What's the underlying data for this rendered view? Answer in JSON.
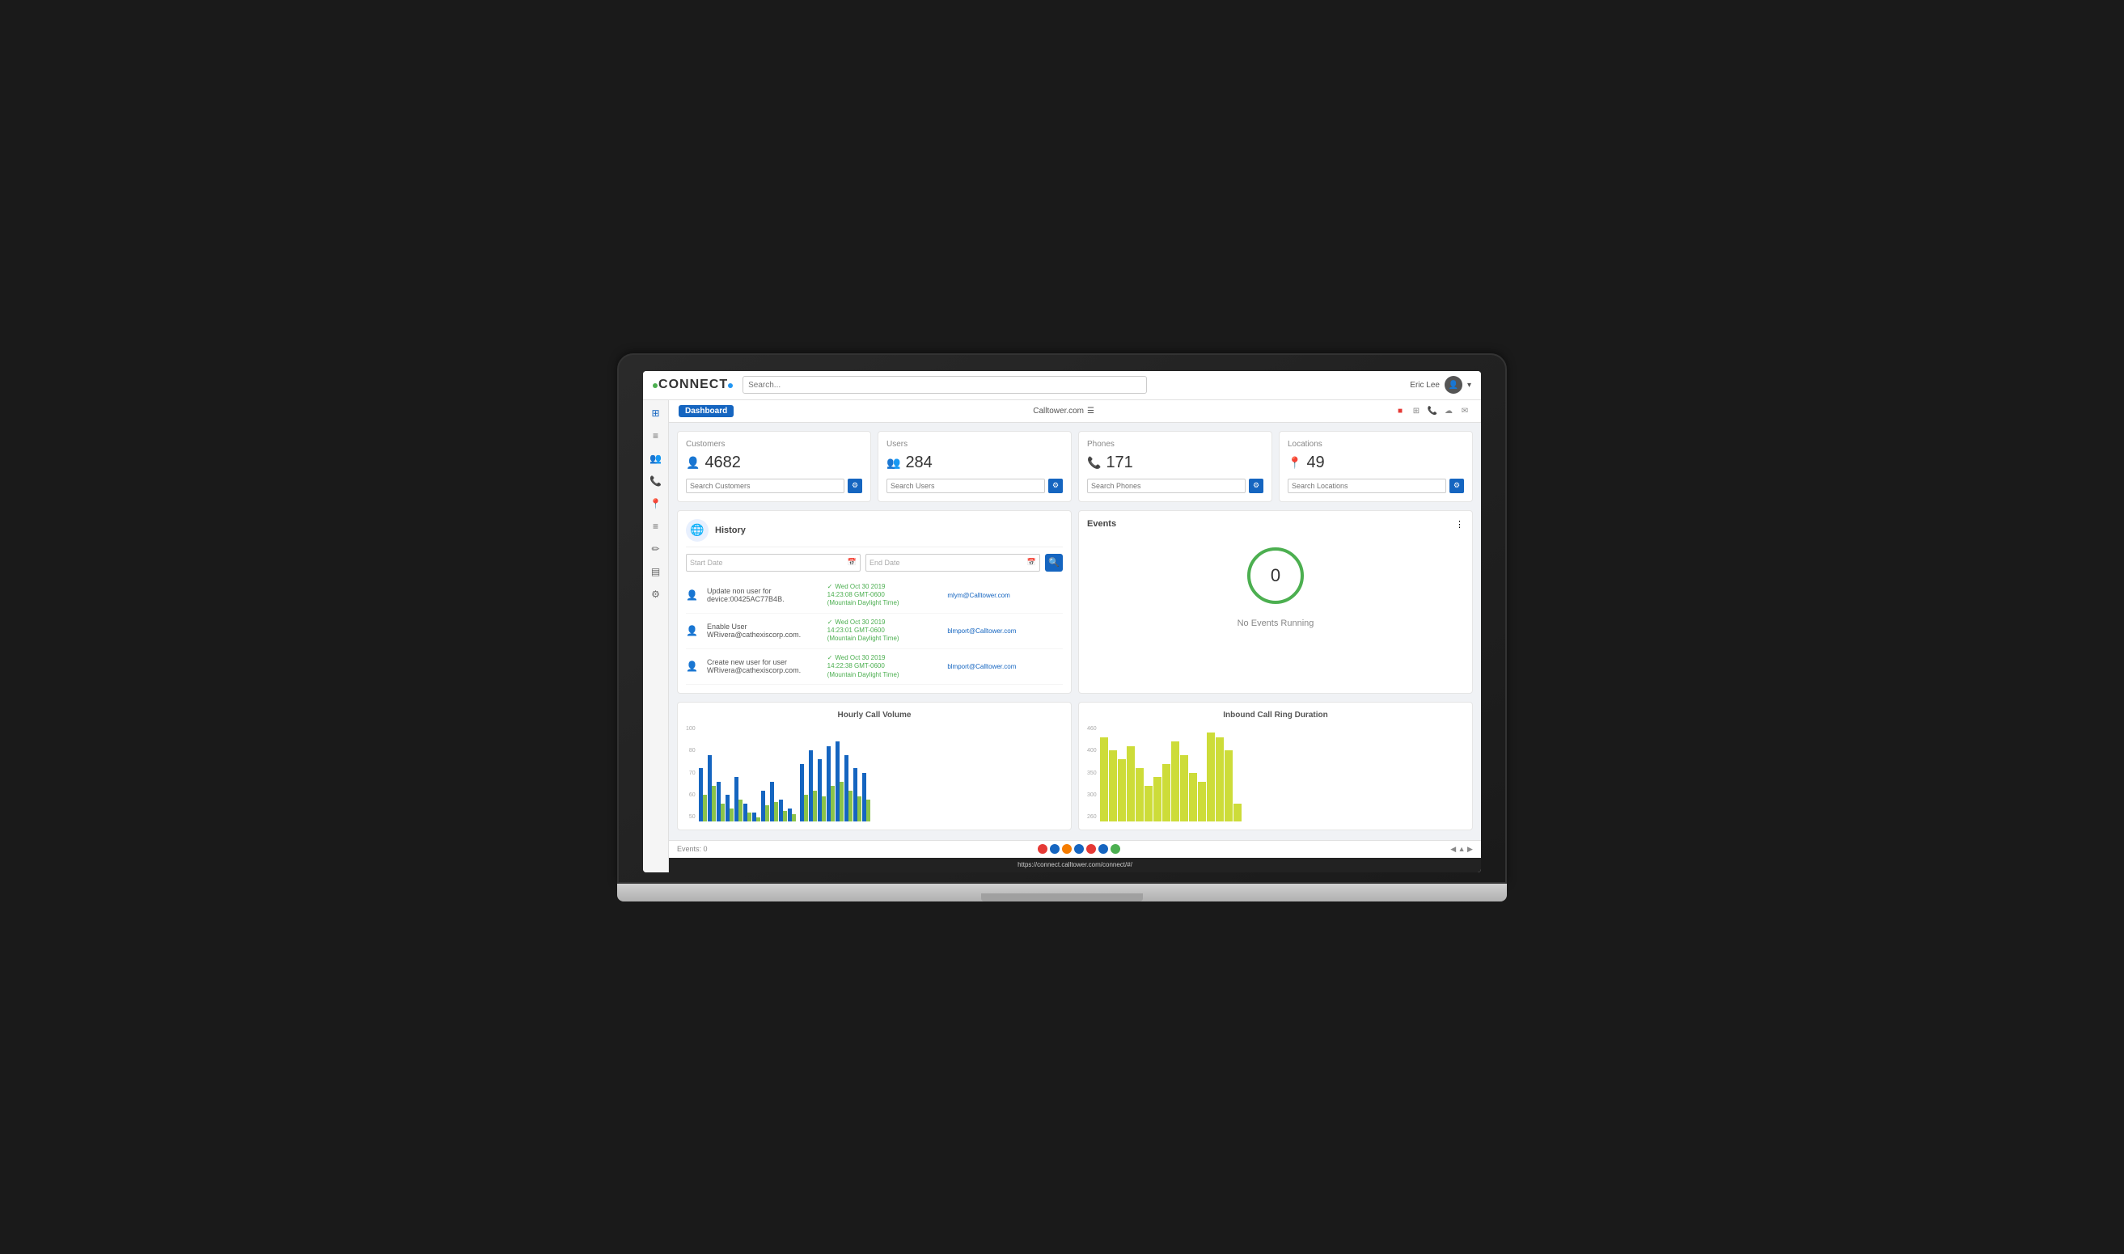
{
  "app": {
    "title": "CONNECT",
    "logo_c": "C",
    "logo_rest": "ONNECT"
  },
  "navbar": {
    "search_placeholder": "Search...",
    "user_name": "Eric Lee"
  },
  "topbar": {
    "dashboard_tab": "Dashboard",
    "calltower_label": "Calltower.com"
  },
  "stats": [
    {
      "label": "Customers",
      "value": "4682",
      "icon": "👤",
      "icon_class": "customers",
      "search_placeholder": "Search Customers"
    },
    {
      "label": "Users",
      "value": "284",
      "icon": "👥",
      "icon_class": "users",
      "search_placeholder": "Search Users"
    },
    {
      "label": "Phones",
      "value": "171",
      "icon": "📞",
      "icon_class": "phones",
      "search_placeholder": "Search Phones"
    },
    {
      "label": "Locations",
      "value": "49",
      "icon": "📍",
      "icon_class": "locations",
      "search_placeholder": "Search Locations"
    }
  ],
  "history": {
    "title": "History",
    "start_date_placeholder": "Start Date",
    "end_date_placeholder": "End Date",
    "items": [
      {
        "description": "Update non user for device:00425AC77B4B.",
        "time": "✓ Wed Oct 30 2019\n14:23:08 GMT-0600\n(Mountain Daylight Time)",
        "user": "mlym@Calltower.com",
        "icon": "person"
      },
      {
        "description": "Enable User WRivera@cathexiscorp.com.",
        "time": "✓ Wed Oct 30 2019\n14:23:01 GMT-0600\n(Mountain Daylight Time)",
        "user": "blmport@Calltower.com",
        "icon": "person"
      },
      {
        "description": "Create new user for user WRivera@cathexiscorp.com.",
        "time": "✓ Wed Oct 30 2019\n14:22:38 GMT-0600\n(Mountain Daylight Time)",
        "user": "blmport@Calltower.com",
        "icon": "person"
      }
    ]
  },
  "events": {
    "title": "Events",
    "count": "0",
    "no_events_text": "No Events Running"
  },
  "hourly_chart": {
    "title": "Hourly Call Volume",
    "y_labels": [
      "100",
      "80",
      "60",
      "50"
    ],
    "bars": [
      {
        "blue": 60,
        "green": 30
      },
      {
        "blue": 75,
        "green": 40
      },
      {
        "blue": 45,
        "green": 20
      },
      {
        "blue": 30,
        "green": 15
      },
      {
        "blue": 50,
        "green": 25
      },
      {
        "blue": 20,
        "green": 10
      },
      {
        "blue": 10,
        "green": 5
      },
      {
        "blue": 35,
        "green": 18
      },
      {
        "blue": 45,
        "green": 22
      },
      {
        "blue": 25,
        "green": 12
      },
      {
        "blue": 15,
        "green": 8
      },
      {
        "blue": 0,
        "green": 0
      },
      {
        "blue": 0,
        "green": 0
      },
      {
        "blue": 0,
        "green": 0
      },
      {
        "blue": 0,
        "green": 0
      },
      {
        "blue": 65,
        "green": 30
      },
      {
        "blue": 80,
        "green": 35
      },
      {
        "blue": 70,
        "green": 28
      },
      {
        "blue": 85,
        "green": 40
      },
      {
        "blue": 90,
        "green": 45
      },
      {
        "blue": 75,
        "green": 35
      },
      {
        "blue": 60,
        "green": 28
      },
      {
        "blue": 55,
        "green": 25
      }
    ]
  },
  "inbound_chart": {
    "title": "Inbound Call Ring Duration",
    "y_labels": [
      "460",
      "400",
      "350",
      "300",
      "260"
    ],
    "bars": [
      {
        "lime": 95
      },
      {
        "lime": 80
      },
      {
        "lime": 70
      },
      {
        "lime": 85
      },
      {
        "lime": 60
      },
      {
        "lime": 40
      },
      {
        "lime": 50
      },
      {
        "lime": 65
      },
      {
        "lime": 90
      },
      {
        "lime": 75
      },
      {
        "lime": 55
      },
      {
        "lime": 45
      },
      {
        "lime": 100
      },
      {
        "lime": 95
      },
      {
        "lime": 80
      },
      {
        "lime": 20
      }
    ]
  },
  "status_bar": {
    "events_text": "Events: 0",
    "url": "https://connect.calltower.com/connect/#/"
  },
  "sidebar": {
    "items": [
      {
        "icon": "⊞",
        "label": "Dashboard",
        "active": true
      },
      {
        "icon": "≡",
        "label": "Menu"
      },
      {
        "icon": "👥",
        "label": "Users"
      },
      {
        "icon": "📞",
        "label": "Phones"
      },
      {
        "icon": "📍",
        "label": "Locations"
      },
      {
        "icon": "≡",
        "label": "List"
      },
      {
        "icon": "✏",
        "label": "Edit"
      },
      {
        "icon": "≡",
        "label": "Reports"
      },
      {
        "icon": "⚙",
        "label": "Settings"
      }
    ]
  },
  "status_dots": [
    {
      "color": "#e53935"
    },
    {
      "color": "#1565C0"
    },
    {
      "color": "#f57c00"
    },
    {
      "color": "#1565C0"
    },
    {
      "color": "#e53935"
    },
    {
      "color": "#1565C0"
    },
    {
      "color": "#4CAF50"
    }
  ]
}
